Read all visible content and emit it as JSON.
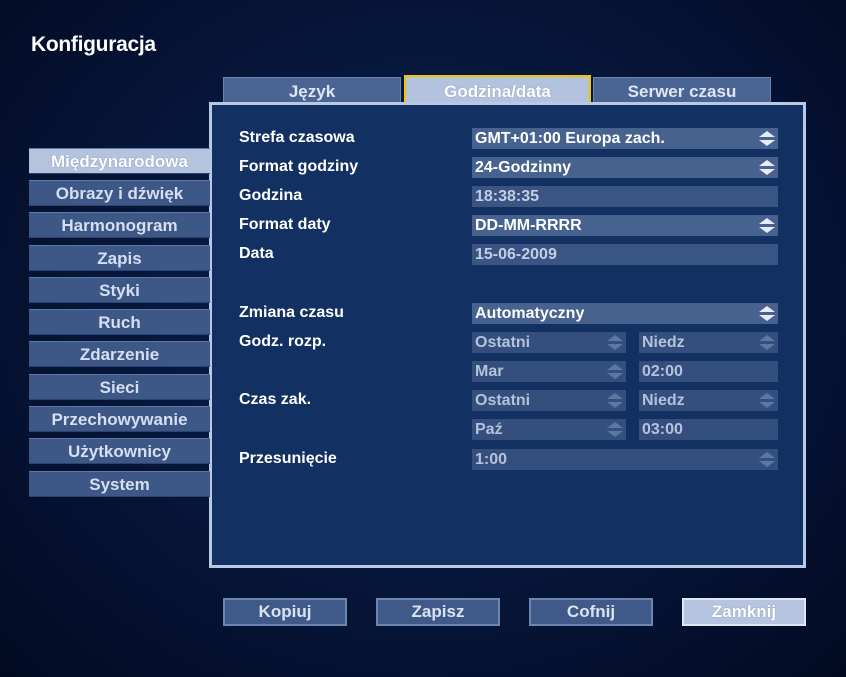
{
  "window": {
    "title": "Konfiguracja"
  },
  "tabs": [
    {
      "label": "Język",
      "active": false
    },
    {
      "label": "Godzina/data",
      "active": true
    },
    {
      "label": "Serwer czasu",
      "active": false
    }
  ],
  "sidebar": {
    "items": [
      {
        "label": "Międzynarodowa",
        "active": true
      },
      {
        "label": "Obrazy i dźwięk"
      },
      {
        "label": "Harmonogram"
      },
      {
        "label": "Zapis"
      },
      {
        "label": "Styki"
      },
      {
        "label": "Ruch"
      },
      {
        "label": "Zdarzenie"
      },
      {
        "label": "Sieci"
      },
      {
        "label": "Przechowywanie"
      },
      {
        "label": "Użytkownicy"
      },
      {
        "label": "System"
      }
    ]
  },
  "form": {
    "timezone": {
      "label": "Strefa czasowa",
      "value": "GMT+01:00 Europa zach."
    },
    "time_format": {
      "label": "Format godziny",
      "value": "24-Godzinny"
    },
    "time": {
      "label": "Godzina",
      "value": "18:38:35"
    },
    "date_format": {
      "label": "Format daty",
      "value": "DD-MM-RRRR"
    },
    "date": {
      "label": "Data",
      "value": "15-06-2009"
    },
    "dst": {
      "label": "Zmiana czasu",
      "value": "Automatyczny"
    },
    "dst_start": {
      "label": "Godz. rozp.",
      "week": "Ostatni",
      "day": "Niedz",
      "month": "Mar",
      "time": "02:00"
    },
    "dst_end": {
      "label": "Czas zak.",
      "week": "Ostatni",
      "day": "Niedz",
      "month": "Paź",
      "time": "03:00"
    },
    "offset": {
      "label": "Przesunięcie",
      "value": "1:00"
    }
  },
  "buttons": {
    "copy": "Kopiuj",
    "save": "Zapisz",
    "undo": "Cofnij",
    "close": "Zamknij"
  },
  "colors": {
    "accent": "#f0c400",
    "panel": "#133063",
    "active": "#b4c4de"
  }
}
